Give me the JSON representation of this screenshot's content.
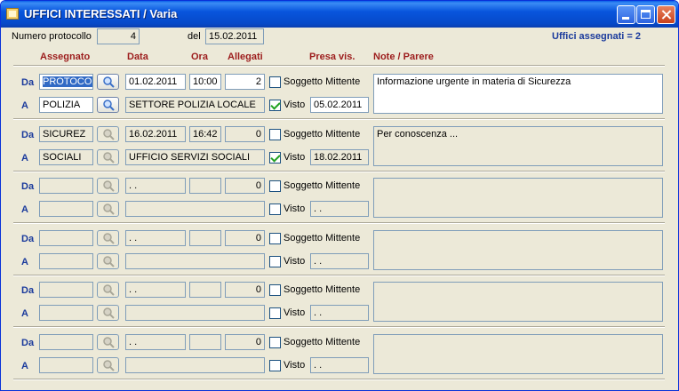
{
  "window": {
    "title": "UFFICI INTERESSATI / Varia"
  },
  "header": {
    "protocol_label": "Numero protocollo",
    "protocol_value": "4",
    "date_label": "del",
    "date_value": "15.02.2011",
    "assigned_summary": "Uffici assegnati = 2"
  },
  "columns": {
    "assegnato": "Assegnato",
    "data": "Data",
    "ora": "Ora",
    "allegati": "Allegati",
    "presa_vis": "Presa vis.",
    "note": "Note / Parere"
  },
  "labels": {
    "da": "Da",
    "a": "A",
    "soggetto_mittente": "Soggetto Mittente",
    "visto": "Visto"
  },
  "icons": {
    "lookup": "magnifier-icon",
    "window": "folder-icon"
  },
  "rows": [
    {
      "da_code": "PROTOCOL",
      "da_date": "01.02.2011",
      "da_time": "10:00",
      "allegati": "2",
      "soggetto_mittente": false,
      "a_code": "POLIZIA",
      "a_desc": "SETTORE POLIZIA LOCALE",
      "visto": true,
      "visto_date": "05.02.2011",
      "note": "Informazione urgente in materia di Sicurezza",
      "active": true
    },
    {
      "da_code": "SICUREZ",
      "da_date": "16.02.2011",
      "da_time": "16:42",
      "allegati": "0",
      "soggetto_mittente": false,
      "a_code": "SOCIALI",
      "a_desc": "UFFICIO SERVIZI SOCIALI",
      "visto": true,
      "visto_date": "18.02.2011",
      "note": "Per conoscenza ...",
      "active": false
    },
    {
      "da_code": "",
      "da_date": " .  .",
      "da_time": "",
      "allegati": "0",
      "soggetto_mittente": false,
      "a_code": "",
      "a_desc": "",
      "visto": false,
      "visto_date": " .  .",
      "note": "",
      "active": false
    },
    {
      "da_code": "",
      "da_date": " .  .",
      "da_time": "",
      "allegati": "0",
      "soggetto_mittente": false,
      "a_code": "",
      "a_desc": "",
      "visto": false,
      "visto_date": " .  .",
      "note": "",
      "active": false
    },
    {
      "da_code": "",
      "da_date": " .  .",
      "da_time": "",
      "allegati": "0",
      "soggetto_mittente": false,
      "a_code": "",
      "a_desc": "",
      "visto": false,
      "visto_date": " .  .",
      "note": "",
      "active": false
    },
    {
      "da_code": "",
      "da_date": " .  .",
      "da_time": "",
      "allegati": "0",
      "soggetto_mittente": false,
      "a_code": "",
      "a_desc": "",
      "visto": false,
      "visto_date": " .  .",
      "note": "",
      "active": false
    }
  ]
}
